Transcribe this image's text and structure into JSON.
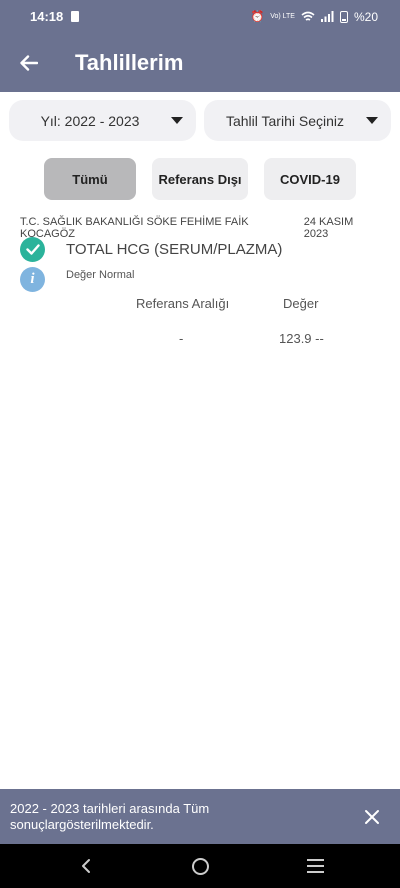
{
  "status_bar": {
    "time": "14:18",
    "network": "Vo) LTE",
    "battery": "%20"
  },
  "header": {
    "title": "Tahlillerim"
  },
  "filters": {
    "year_label": "Yıl: 2022 - 2023",
    "date_label": "Tahlil Tarihi Seçiniz"
  },
  "tabs": [
    {
      "label": "Tümü",
      "active": true
    },
    {
      "label": "Referans Dışı",
      "active": false
    },
    {
      "label": "COVID-19",
      "active": false
    }
  ],
  "result": {
    "hospital": "T.C. SAĞLIK BAKANLIĞI SÖKE FEHİME FAİK KOCAGÖZ",
    "date": "24 KASIM 2023",
    "test_name": "TOTAL HCG (SERUM/PLAZMA)",
    "status": "Değer Normal",
    "ref_header": "Referans Aralığı",
    "value_header": "Değer",
    "ref_value": "-",
    "value": "123.9 --"
  },
  "snackbar": {
    "message": "2022 - 2023 tarihleri arasında Tüm sonuçlargösterilmektedir."
  },
  "colors": {
    "header": "#6b7290",
    "active_tab": "#b8b8ba",
    "check": "#2bb39b",
    "info": "#7fb4df"
  }
}
